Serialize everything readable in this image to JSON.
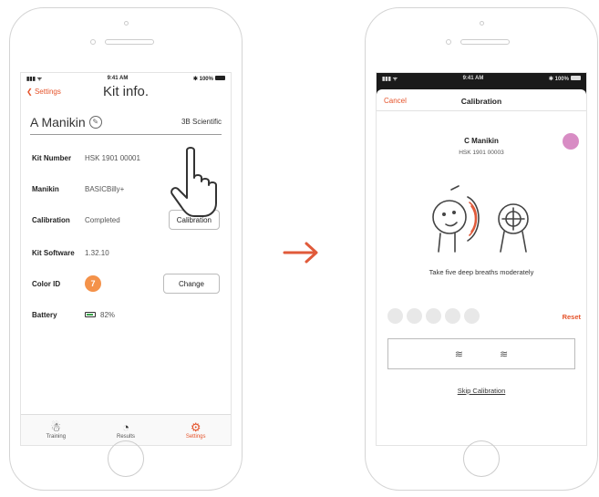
{
  "colors": {
    "accent": "#e5532a",
    "color_id": "#f4924a",
    "calibration_dot": "#d88cc4",
    "arrow": "#e05a3a"
  },
  "left_screen": {
    "status": {
      "time": "9:41 AM",
      "battery": "100%"
    },
    "nav": {
      "back_label": "Settings",
      "title": "Kit info."
    },
    "kit_name": "A Manikin",
    "brand": "3B Scientific",
    "rows": {
      "kit_number": {
        "label": "Kit Number",
        "value": "HSK 1901 00001"
      },
      "manikin": {
        "label": "Manikin",
        "value": "BASICBilly+"
      },
      "calibration": {
        "label": "Calibration",
        "value": "Completed",
        "button": "Calibration"
      },
      "kit_software": {
        "label": "Kit Software",
        "value": "1.32.10"
      },
      "color_id": {
        "label": "Color ID",
        "value": "7",
        "button": "Change"
      },
      "battery": {
        "label": "Battery",
        "value": "82%"
      }
    },
    "tabs": [
      {
        "label": "Training",
        "icon": "training-icon"
      },
      {
        "label": "Results",
        "icon": "results-icon"
      },
      {
        "label": "Settings",
        "icon": "settings-gear-icon"
      }
    ]
  },
  "right_screen": {
    "status": {
      "time": "9:41 AM",
      "battery": "100%"
    },
    "cancel_label": "Cancel",
    "title": "Calibration",
    "manikin_name": "C Manikin",
    "manikin_number": "HSK 1901 00003",
    "instruction": "Take five deep breaths moderately",
    "breath_dots": 5,
    "reset_label": "Reset",
    "skip_label": "Skip Calibration"
  }
}
